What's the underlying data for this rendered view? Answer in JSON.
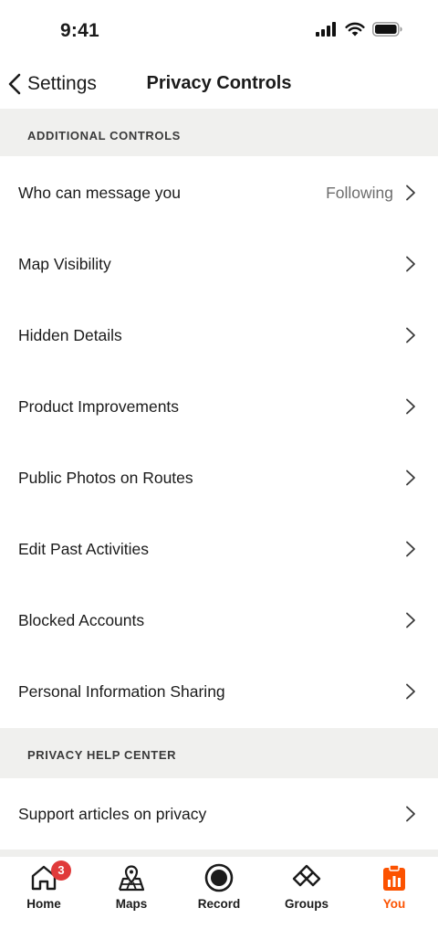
{
  "status": {
    "time": "9:41"
  },
  "nav": {
    "back_label": "Settings",
    "title": "Privacy Controls"
  },
  "sections": {
    "additional_controls": {
      "header": "ADDITIONAL CONTROLS",
      "rows": [
        {
          "label": "Who can message you",
          "value": "Following"
        },
        {
          "label": "Map Visibility"
        },
        {
          "label": "Hidden Details"
        },
        {
          "label": "Product Improvements"
        },
        {
          "label": "Public Photos on Routes"
        },
        {
          "label": "Edit Past Activities"
        },
        {
          "label": "Blocked Accounts"
        },
        {
          "label": "Personal Information Sharing"
        }
      ]
    },
    "help_center": {
      "header": "PRIVACY HELP CENTER",
      "rows": [
        {
          "label": "Support articles on privacy"
        }
      ]
    }
  },
  "tabs": [
    {
      "label": "Home",
      "icon": "home-icon",
      "badge": "3"
    },
    {
      "label": "Maps",
      "icon": "map-icon"
    },
    {
      "label": "Record",
      "icon": "record-icon"
    },
    {
      "label": "Groups",
      "icon": "groups-icon"
    },
    {
      "label": "You",
      "icon": "you-icon",
      "active": true
    }
  ],
  "colors": {
    "accent": "#fc5200",
    "badge": "#e03a3a",
    "section_bg": "#f0f0ee"
  }
}
